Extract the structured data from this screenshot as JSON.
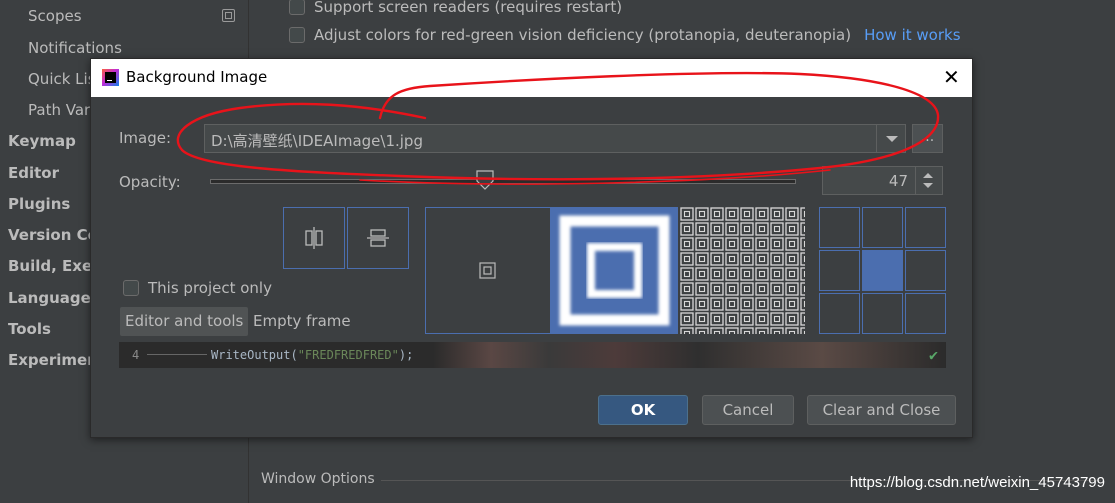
{
  "sidebar": {
    "items": [
      {
        "label": "Scopes"
      },
      {
        "label": "Notifications"
      },
      {
        "label": "Quick Lis"
      },
      {
        "label": "Path Vari"
      },
      {
        "label": "Keymap"
      },
      {
        "label": "Editor"
      },
      {
        "label": "Plugins"
      },
      {
        "label": "Version Co"
      },
      {
        "label": "Build, Exec"
      },
      {
        "label": "Languages"
      },
      {
        "label": "Tools"
      },
      {
        "label": "Experiment"
      }
    ]
  },
  "settings": {
    "screen_readers_label": "Support screen readers (requires restart)",
    "adjust_colors_label": "Adjust colors for red-green vision deficiency (protanopia, deuteranopia)",
    "how_it_works_link": "How it works",
    "window_options_label": "Window Options"
  },
  "dialog": {
    "title": "Background Image",
    "image_label": "Image:",
    "image_path": "D:\\高清壁纸\\IDEAImage\\1.jpg",
    "browse_label": "...",
    "opacity_label": "Opacity:",
    "opacity_value": "47",
    "opacity_fraction": 0.47,
    "project_only_label": "This project only",
    "target_editor_label": "Editor and tools",
    "target_empty_label": "Empty frame",
    "preview": {
      "line_number": "4",
      "code_fn": "WriteOutput(",
      "code_str": "\"FREDFREDFRED\"",
      "code_end": ");"
    },
    "ok_label": "OK",
    "cancel_label": "Cancel",
    "clear_label": "Clear and Close"
  },
  "watermark": "https://blog.csdn.net/weixin_45743799",
  "colors": {
    "accent": "#4b6eaf",
    "annotation": "#e8131a",
    "link": "#589df6"
  }
}
